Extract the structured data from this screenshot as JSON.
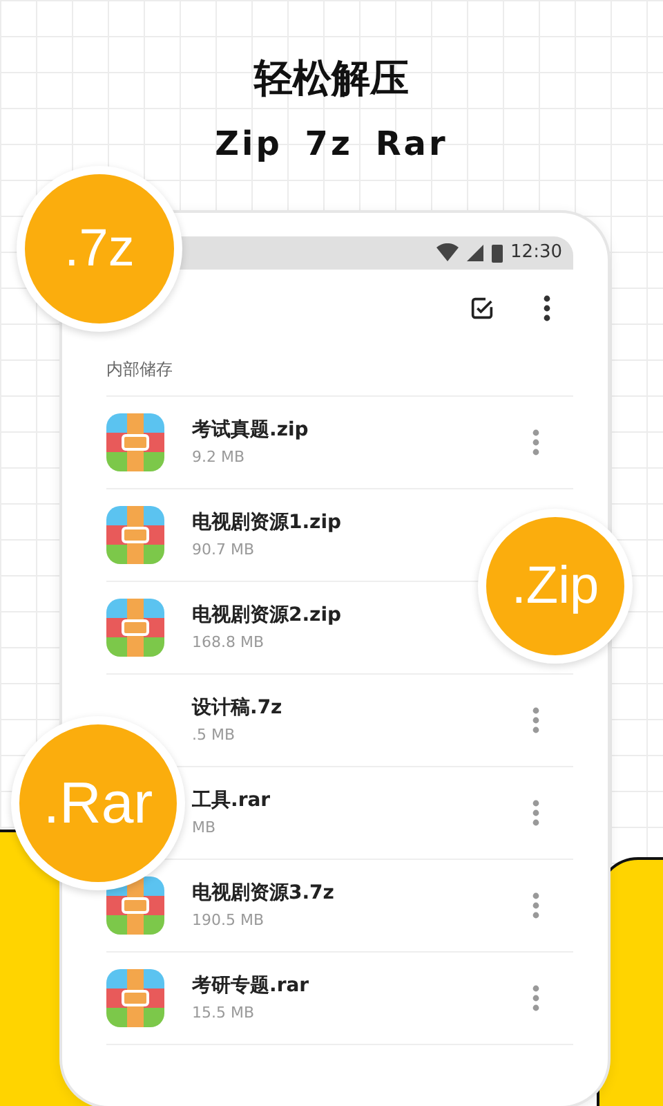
{
  "header": {
    "title": "轻松解压",
    "subtitle": "Zip 7z Rar"
  },
  "status_bar": {
    "time": "12:30"
  },
  "section_label": "内部储存",
  "files": [
    {
      "name": "考试真题.zip",
      "size": "9.2 MB",
      "has_menu": true,
      "icon_covered": false
    },
    {
      "name": "电视剧资源1.zip",
      "size": "90.7 MB",
      "has_menu": false,
      "icon_covered": false
    },
    {
      "name": "电视剧资源2.zip",
      "size": "168.8 MB",
      "has_menu": false,
      "icon_covered": false
    },
    {
      "name": "设计稿.7z",
      "size": ".5 MB",
      "has_menu": true,
      "icon_covered": true
    },
    {
      "name": "工具.rar",
      "size": "MB",
      "has_menu": true,
      "icon_covered": true
    },
    {
      "name": "电视剧资源3.7z",
      "size": "190.5 MB",
      "has_menu": true,
      "icon_covered": false
    },
    {
      "name": "考研专题.rar",
      "size": "15.5 MB",
      "has_menu": true,
      "icon_covered": false
    }
  ],
  "badges": [
    {
      "label": ".7z",
      "kind": "top"
    },
    {
      "label": ".Zip",
      "kind": "right"
    },
    {
      "label": ".Rar",
      "kind": "left"
    }
  ]
}
